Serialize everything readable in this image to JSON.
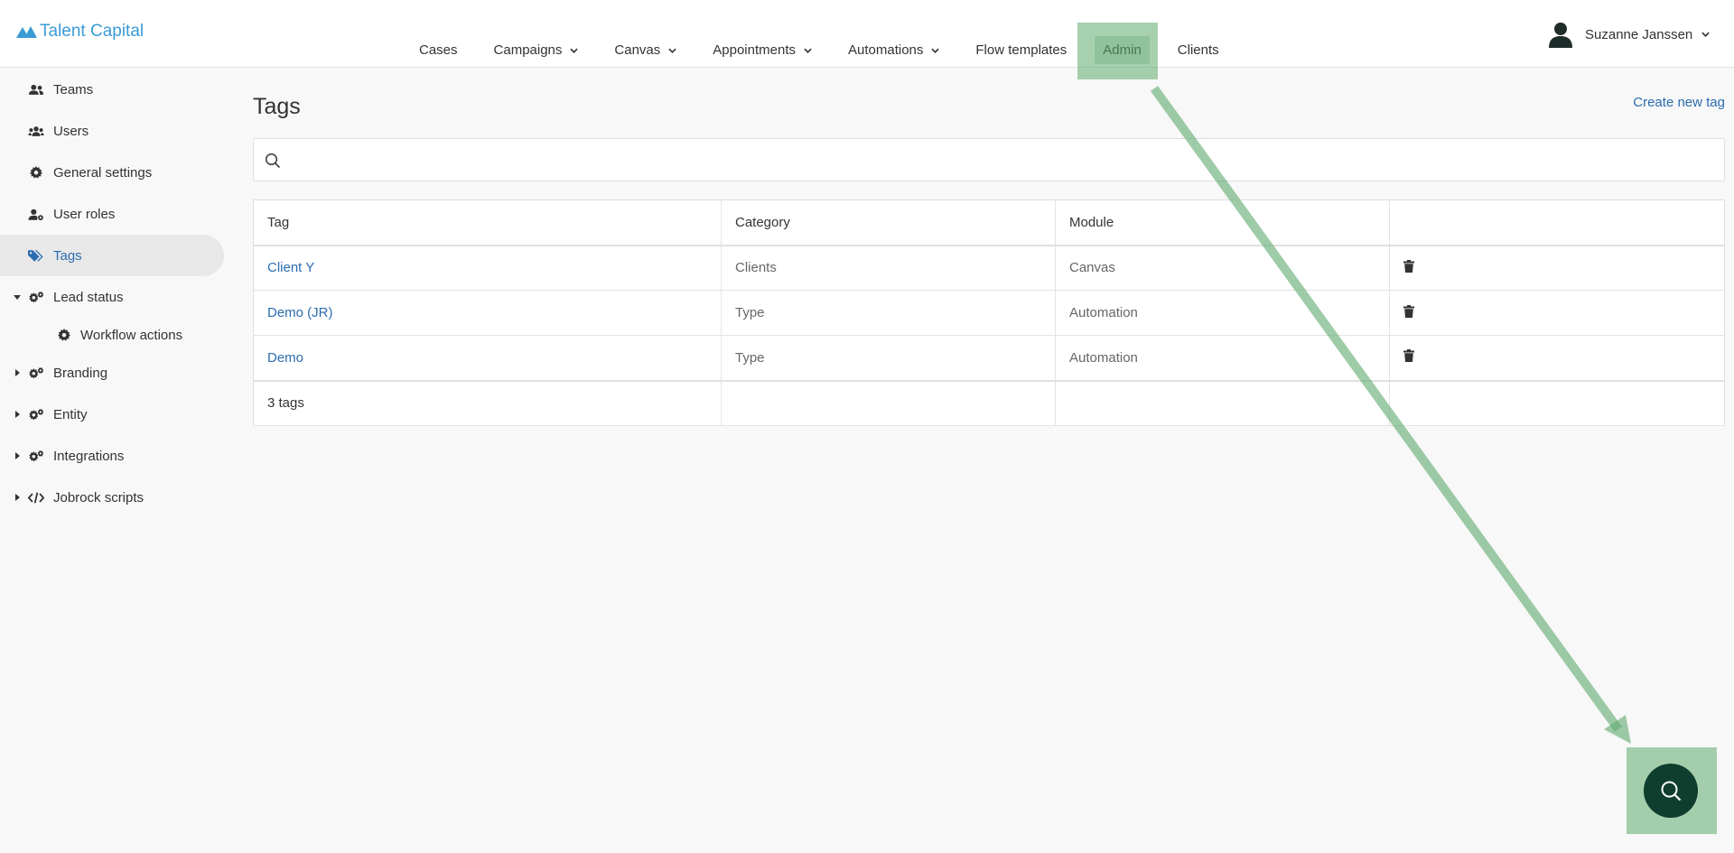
{
  "header": {
    "logo_text": "Talent Capital",
    "nav": [
      {
        "label": "Cases",
        "dropdown": false
      },
      {
        "label": "Campaigns",
        "dropdown": true
      },
      {
        "label": "Canvas",
        "dropdown": true
      },
      {
        "label": "Appointments",
        "dropdown": true
      },
      {
        "label": "Automations",
        "dropdown": true
      },
      {
        "label": "Flow templates",
        "dropdown": false
      },
      {
        "label": "Admin",
        "dropdown": false,
        "active": true
      },
      {
        "label": "Clients",
        "dropdown": false
      }
    ],
    "user_name": "Suzanne Janssen"
  },
  "sidebar": {
    "items": [
      {
        "label": "Teams",
        "icon": "users-icon"
      },
      {
        "label": "Users",
        "icon": "user-group-icon"
      },
      {
        "label": "General settings",
        "icon": "gear-icon"
      },
      {
        "label": "User roles",
        "icon": "user-cog-icon"
      },
      {
        "label": "Tags",
        "icon": "tags-icon",
        "active": true
      },
      {
        "label": "Lead status",
        "icon": "gears-icon",
        "expanded": true
      },
      {
        "label": "Workflow actions",
        "icon": "gear-icon"
      },
      {
        "label": "Branding",
        "icon": "gears-icon"
      },
      {
        "label": "Entity",
        "icon": "gears-icon"
      },
      {
        "label": "Integrations",
        "icon": "gears-icon"
      },
      {
        "label": "Jobrock scripts",
        "icon": "code-icon"
      }
    ]
  },
  "main": {
    "title": "Tags",
    "create_link": "Create new tag",
    "search": {
      "value": "",
      "placeholder": ""
    },
    "table": {
      "headers": [
        "Tag",
        "Category",
        "Module",
        ""
      ],
      "rows": [
        {
          "tag": "Client Y",
          "category": "Clients",
          "module": "Canvas"
        },
        {
          "tag": "Demo (JR)",
          "category": "Type",
          "module": "Automation"
        },
        {
          "tag": "Demo",
          "category": "Type",
          "module": "Automation"
        }
      ],
      "footer": "3 tags"
    }
  },
  "colors": {
    "accent": "#2b6cb0",
    "logo": "#3a9bd5",
    "fab": "#0f3d2e",
    "annotation": "#5faa6e"
  }
}
